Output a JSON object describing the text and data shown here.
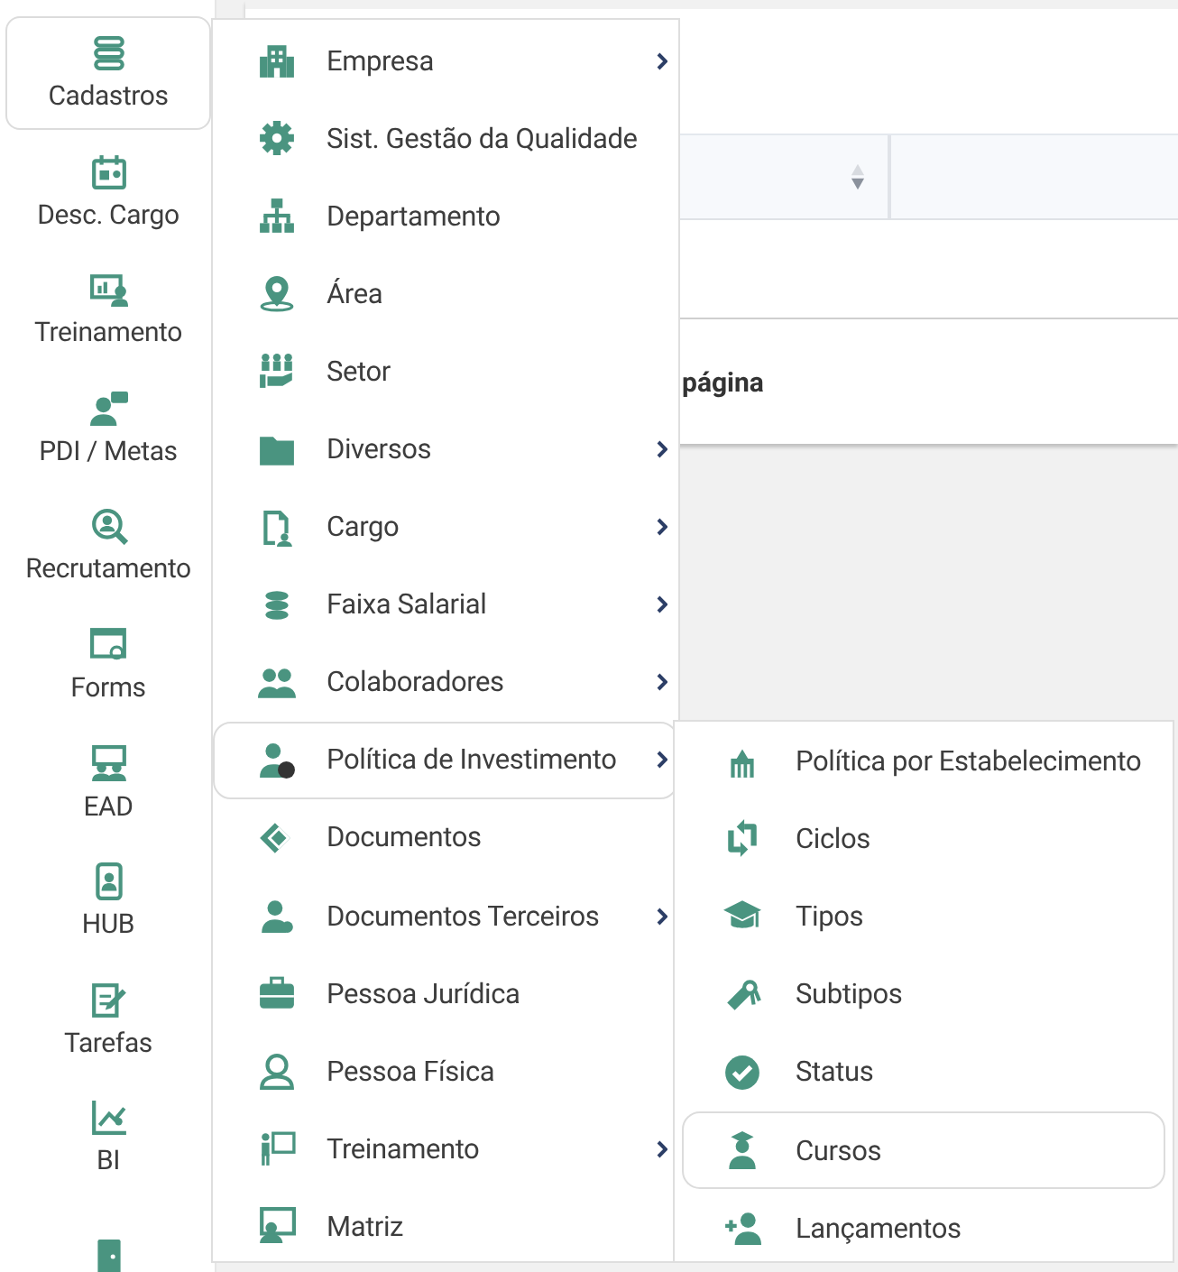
{
  "sidebar": {
    "items": [
      {
        "label": "Cadastros",
        "selected": true
      },
      {
        "label": "Desc. Cargo",
        "selected": false
      },
      {
        "label": "Treinamento",
        "selected": false
      },
      {
        "label": "PDI / Metas",
        "selected": false
      },
      {
        "label": "Recrutamento",
        "selected": false
      },
      {
        "label": "Forms",
        "selected": false
      },
      {
        "label": "EAD",
        "selected": false
      },
      {
        "label": "HUB",
        "selected": false
      },
      {
        "label": "Tarefas",
        "selected": false
      },
      {
        "label": "BI",
        "selected": false
      },
      {
        "selected": false
      }
    ]
  },
  "page": {
    "footer_text": "página"
  },
  "menu": {
    "items": [
      {
        "label": "Empresa",
        "has_submenu": true,
        "selected": false
      },
      {
        "label": "Sist. Gestão da Qualidade",
        "has_submenu": false,
        "selected": false
      },
      {
        "label": "Departamento",
        "has_submenu": false,
        "selected": false
      },
      {
        "label": "Área",
        "has_submenu": false,
        "selected": false
      },
      {
        "label": "Setor",
        "has_submenu": false,
        "selected": false
      },
      {
        "label": "Diversos",
        "has_submenu": true,
        "selected": false
      },
      {
        "label": "Cargo",
        "has_submenu": true,
        "selected": false
      },
      {
        "label": "Faixa Salarial",
        "has_submenu": true,
        "selected": false
      },
      {
        "label": "Colaboradores",
        "has_submenu": true,
        "selected": false
      },
      {
        "label": "Política de Investimento",
        "has_submenu": true,
        "selected": true
      },
      {
        "label": "Documentos",
        "has_submenu": false,
        "selected": false
      },
      {
        "label": "Documentos Terceiros",
        "has_submenu": true,
        "selected": false
      },
      {
        "label": "Pessoa Jurídica",
        "has_submenu": false,
        "selected": false
      },
      {
        "label": "Pessoa Física",
        "has_submenu": false,
        "selected": false
      },
      {
        "label": "Treinamento",
        "has_submenu": true,
        "selected": false
      },
      {
        "label": "Matriz",
        "has_submenu": false,
        "selected": false
      }
    ]
  },
  "submenu": {
    "items": [
      {
        "label": "Política por Estabelecimento",
        "selected": false
      },
      {
        "label": "Ciclos",
        "selected": false
      },
      {
        "label": "Tipos",
        "selected": false
      },
      {
        "label": "Subtipos",
        "selected": false
      },
      {
        "label": "Status",
        "selected": false
      },
      {
        "label": "Cursos",
        "selected": true
      },
      {
        "label": "Lançamentos",
        "selected": false
      }
    ]
  }
}
